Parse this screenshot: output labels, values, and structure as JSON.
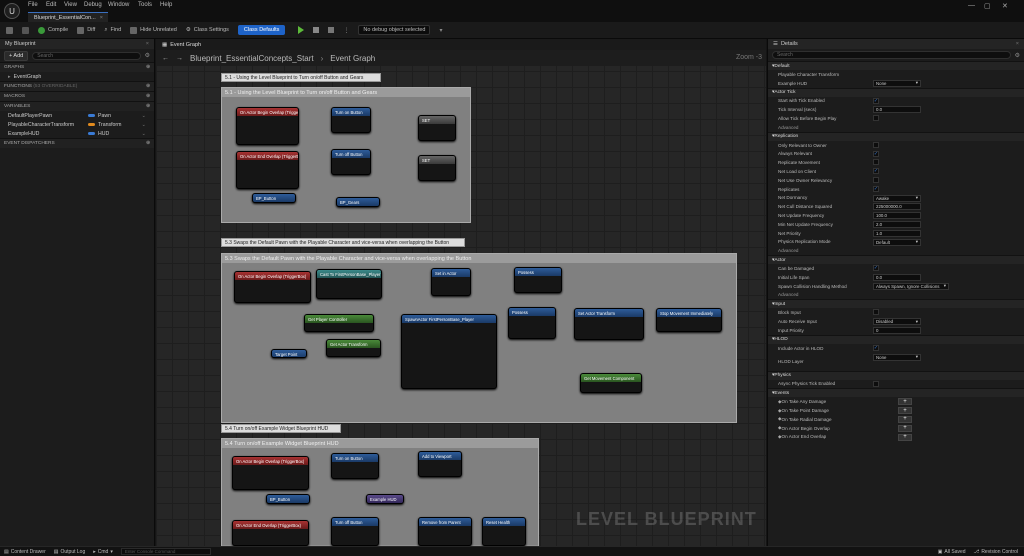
{
  "titlebar": {
    "menus": [
      "File",
      "Edit",
      "View",
      "Debug",
      "Window",
      "Tools",
      "Help"
    ],
    "tab": "Blueprint_EssentialCon..."
  },
  "toolbar": {
    "compile": "Compile",
    "diff": "Diff",
    "find": "Find",
    "hide_unrelated": "Hide Unrelated",
    "class_settings": "Class Settings",
    "class_defaults": "Class Defaults",
    "debug_object": "No debug object selected"
  },
  "left": {
    "title": "My Blueprint",
    "add": "+ Add",
    "search": "Search",
    "graphs": "GRAPHS",
    "event_graph": "EventGraph",
    "functions": "FUNCTIONS",
    "functions_note": "(53 OVERRIDABLE)",
    "macros": "MACROS",
    "variables": "VARIABLES",
    "dispatchers": "EVENT DISPATCHERS",
    "vars": [
      {
        "name": "DefaultPlayerPawn",
        "type": "Pawn",
        "color": "#3a7bd5"
      },
      {
        "name": "PlayableCharacterTransform",
        "type": "Transform",
        "color": "#e08a1e"
      },
      {
        "name": "ExampleHUD",
        "type": "HUD",
        "color": "#3a7bd5"
      }
    ]
  },
  "graph": {
    "tab": "Event Graph",
    "breadcrumb_root": "Blueprint_EssentialConcepts_Start",
    "breadcrumb_leaf": "Event Graph",
    "zoom": "Zoom -3",
    "watermark": "LEVEL BLUEPRINT",
    "header1": "5.1 - Using the Level Blueprint to Turn on/off Button and Gears",
    "comment1": "5.1 - Using the Level Blueprint to Turn on/off Button and Gears",
    "header2": "5.3 Swaps the Default Pawn with the Playable Character and vice-versa when overlapping the Button",
    "comment2": "5.3 Swaps the Default Pawn with the Playable Character and vice-versa when overlapping the Button",
    "header3": "5.4 Turn on/off Example Widget Blueprint HUD",
    "comment3": "5.4 Turn on/off Example Widget Blueprint HUD",
    "n1": "On Actor Begin Overlap (TriggerBox)",
    "n2": "Turn on Button",
    "n3": "SET",
    "n4": "On Actor End Overlap (TriggerBox)",
    "n5": "Turn off Button",
    "n6": "SET",
    "n7": "BP_Button",
    "n8": "BP_Gears",
    "n9": "On Actor Begin Overlap (TriggerBox)",
    "n10": "Cast To FirstPersonBase_Player",
    "n11": "Get Player Controller",
    "n12": "Get Actor Transform",
    "n13": "SpawnActor FirstPersonBase_Player",
    "n14": "Possess",
    "n15": "Set Actor Transform",
    "n16": "Stop Movement Immediately",
    "n17": "Get Movement Component",
    "n18": "Possess",
    "n19": "Set in Actor",
    "n20": "Target Point",
    "n21": "On Actor Begin Overlap (TriggerBox)",
    "n22": "Turn on Button",
    "n23": "Add to Viewport",
    "n24": "BP_Button",
    "n25": "Example HUD",
    "n26": "On Actor End Overlap (TriggerBox)",
    "n27": "Turn off Button",
    "n28": "Remove from Parent",
    "n29": "Reset Health"
  },
  "details": {
    "title": "Details",
    "search": "Search",
    "sections": [
      {
        "name": "Default",
        "rows": [
          {
            "label": "Playable Character Transform"
          },
          {
            "label": "Example HUD",
            "sel": "None"
          }
        ]
      },
      {
        "name": "Actor Tick",
        "rows": [
          {
            "label": "Start with Tick Enabled",
            "chk": "✓"
          },
          {
            "label": "Tick Interval (secs)",
            "val": "0.0"
          },
          {
            "label": "Allow Tick Before Begin Play",
            "chk": ""
          },
          {
            "label": "Advanced"
          }
        ]
      },
      {
        "name": "Replication",
        "rows": [
          {
            "label": "Only Relevant to Owner",
            "chk": ""
          },
          {
            "label": "Always Relevant",
            "chk": "✓"
          },
          {
            "label": "Replicate Movement",
            "chk": ""
          },
          {
            "label": "Net Load on Client",
            "chk": "✓"
          },
          {
            "label": "Net Use Owner Relevancy",
            "chk": ""
          },
          {
            "label": "Replicates",
            "chk": "✓"
          },
          {
            "label": "Net Dormancy",
            "sel": "Awake"
          },
          {
            "label": "Net Cull Distance Squared",
            "val": "225000000.0"
          },
          {
            "label": "Net Update Frequency",
            "val": "100.0"
          },
          {
            "label": "Min Net Update Frequency",
            "val": "2.0"
          },
          {
            "label": "Net Priority",
            "val": "1.0"
          },
          {
            "label": "Physics Replication Mode",
            "sel": "Default"
          },
          {
            "label": "Advanced"
          }
        ]
      },
      {
        "name": "Actor",
        "rows": [
          {
            "label": "Can be Damaged",
            "chk": "✓"
          },
          {
            "label": "Initial Life Span",
            "val": "0.0"
          },
          {
            "label": "Spawn Collision Handling Method",
            "sel": "Always Spawn, Ignore Collisions"
          },
          {
            "label": "Advanced"
          }
        ]
      },
      {
        "name": "Input",
        "rows": [
          {
            "label": "Block Input",
            "chk": ""
          },
          {
            "label": "Auto Receive Input",
            "sel": "Disabled"
          },
          {
            "label": "Input Priority",
            "val": "0"
          }
        ]
      },
      {
        "name": "HLOD",
        "rows": [
          {
            "label": "Include Actor in HLOD",
            "chk": "✓"
          },
          {
            "label": "HLOD Layer",
            "sel": "None",
            "big": true
          }
        ]
      },
      {
        "name": "Physics",
        "rows": [
          {
            "label": "Async Physics Tick Enabled",
            "chk": ""
          }
        ]
      },
      {
        "name": "Events",
        "rows": [
          {
            "label": "On Take Any Damage",
            "plus": "+"
          },
          {
            "label": "On Take Point Damage",
            "plus": "+"
          },
          {
            "label": "On Take Radial Damage",
            "plus": "+"
          },
          {
            "label": "On Actor Begin Overlap",
            "plus": "+"
          },
          {
            "label": "On Actor End Overlap",
            "plus": "+"
          }
        ]
      }
    ]
  },
  "status": {
    "content_drawer": "Content Drawer",
    "output_log": "Output Log",
    "cmd": "Cmd",
    "console": "Enter Console Command",
    "saved": "All Saved",
    "revision": "Revision Control"
  }
}
